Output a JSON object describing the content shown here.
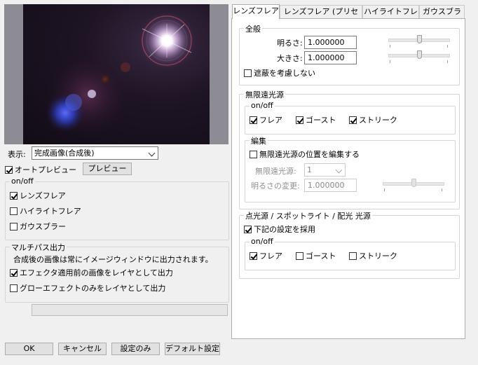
{
  "left": {
    "display_label": "表示:",
    "display_value": "完成画像(合成後)",
    "auto_preview": {
      "label": "オートプレビュー",
      "checked": true
    },
    "preview_button": "プレビュー",
    "onoff_group": {
      "title": "on/off",
      "items": [
        {
          "label": "レンズフレア",
          "checked": true
        },
        {
          "label": "ハイライトフレア",
          "checked": false
        },
        {
          "label": "ガウスブラー",
          "checked": false
        }
      ]
    },
    "multipass_group": {
      "title": "マルチパス出力",
      "note": "合成後の画像は常にイメージウィンドウに出力されます。",
      "items": [
        {
          "label": "エフェクタ適用前の画像をレイヤとして出力",
          "checked": true
        },
        {
          "label": "グローエフェクトのみをレイヤとして出力",
          "checked": false
        }
      ]
    }
  },
  "buttons": {
    "ok": "OK",
    "cancel": "キャンセル",
    "settings_only": "設定のみ",
    "default": "デフォルト設定"
  },
  "tabs": [
    {
      "label": "レンズフレア",
      "active": true
    },
    {
      "label": "レンズフレア (プリセット)",
      "active": false
    },
    {
      "label": "ハイライトフレア",
      "active": false
    },
    {
      "label": "ガウスブラー",
      "active": false
    }
  ],
  "general": {
    "title": "全般",
    "brightness_label": "明るさ:",
    "brightness_value": "1.000000",
    "brightness_level": 0.5,
    "size_label": "大きさ:",
    "size_value": "1.000000",
    "size_level": 0.5,
    "ignore_occlusion": {
      "label": "遮蔽を考慮しない",
      "checked": false
    }
  },
  "infinite": {
    "title": "無限遠光源",
    "onoff": {
      "title": "on/off",
      "items": [
        {
          "label": "フレア",
          "checked": true
        },
        {
          "label": "ゴースト",
          "checked": true
        },
        {
          "label": "ストリーク",
          "checked": true
        }
      ]
    },
    "edit": {
      "title": "編集",
      "edit_position": {
        "label": "無限遠光源の位置を編集する",
        "checked": false
      },
      "source_label": "無限遠光源:",
      "source_value": "1",
      "brightness_change_label": "明るさの変更:",
      "brightness_change_value": "1.000000",
      "brightness_change_level": 0.5
    }
  },
  "point": {
    "title": "点光源 / スポットライト / 配光 光源",
    "use_settings": {
      "label": "下記の設定を採用",
      "checked": true
    },
    "onoff": {
      "title": "on/off",
      "items": [
        {
          "label": "フレア",
          "checked": true
        },
        {
          "label": "ゴースト",
          "checked": false
        },
        {
          "label": "ストリーク",
          "checked": false
        }
      ]
    }
  }
}
